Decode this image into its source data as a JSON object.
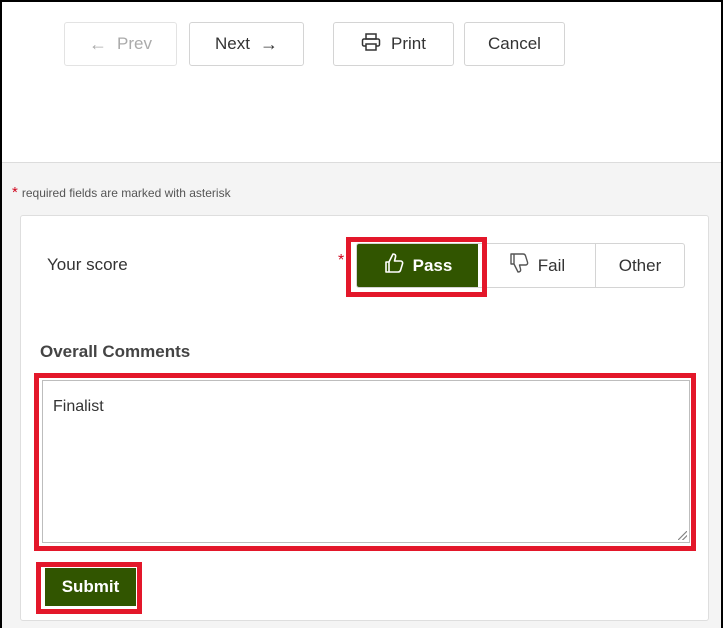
{
  "toolbar": {
    "prev_label": "Prev",
    "next_label": "Next",
    "print_label": "Print",
    "cancel_label": "Cancel"
  },
  "form": {
    "required_note": "required fields are marked with asterisk",
    "required_marker": "*",
    "score_label": "Your score",
    "score_options": {
      "pass": "Pass",
      "fail": "Fail",
      "other": "Other"
    },
    "selected_score": "Pass",
    "comments_label": "Overall Comments",
    "comments_value": "Finalist",
    "submit_label": "Submit"
  },
  "colors": {
    "accent": "#315500",
    "highlight": "#e3172a",
    "required": "#d0021b"
  },
  "icons": {
    "prev": "arrow-left-icon",
    "next": "arrow-right-icon",
    "print": "printer-icon",
    "pass": "thumbs-up-icon",
    "fail": "thumbs-down-icon"
  }
}
